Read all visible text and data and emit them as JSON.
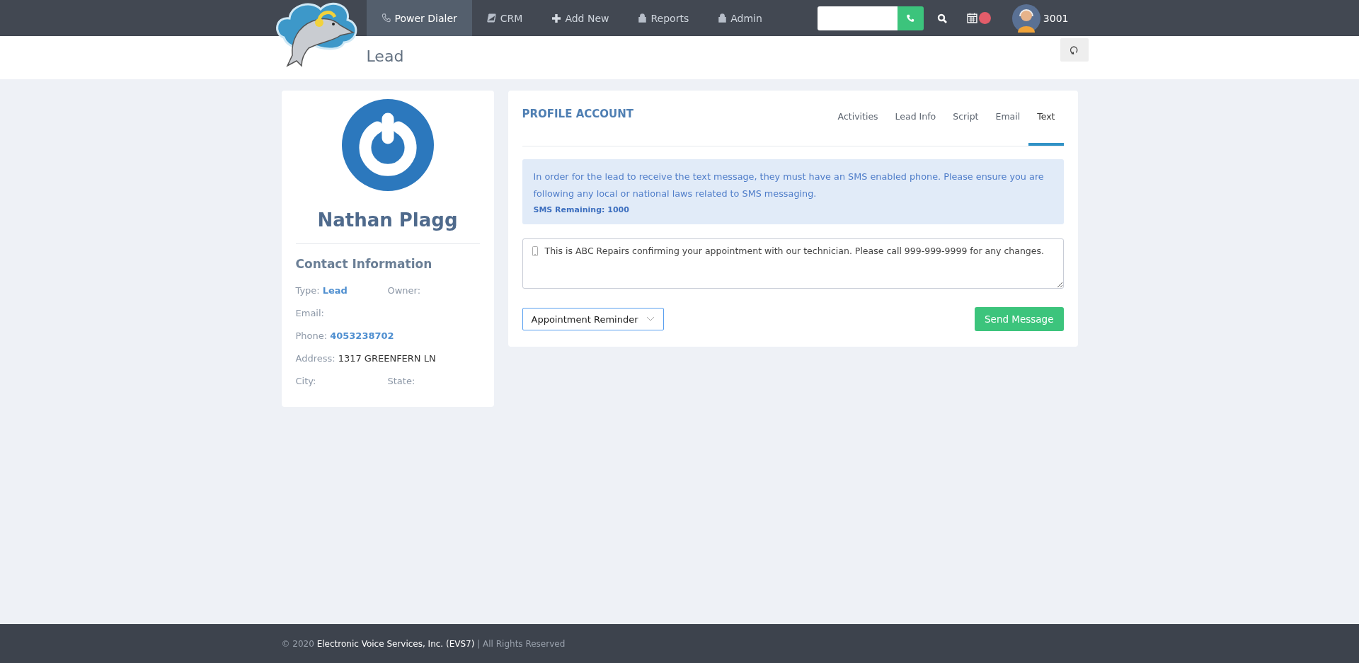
{
  "nav": {
    "items": [
      {
        "label": "Power Dialer",
        "kind": "phone",
        "selected": true
      },
      {
        "label": "CRM",
        "kind": "book",
        "selected": false
      },
      {
        "label": "Add New",
        "kind": "plus",
        "selected": false
      },
      {
        "label": "Reports",
        "kind": "lock",
        "selected": false
      },
      {
        "label": "Admin",
        "kind": "lock",
        "selected": false
      }
    ],
    "calendar_alert": true,
    "user": "3001"
  },
  "page_title": "Lead",
  "profile": {
    "name": "Nathan Plagg",
    "section_title": "Contact Information",
    "rows": [
      [
        {
          "label": "Type:",
          "value": "Lead",
          "kind": "link"
        },
        {
          "label": "Owner:"
        }
      ],
      [
        {
          "label": "Email:"
        }
      ],
      [
        {
          "label": "Phone:",
          "value": "4053238702",
          "kind": "link"
        }
      ],
      [
        {
          "label": "Address:",
          "value": "1317 GREENFERN LN",
          "kind": "text"
        }
      ],
      [
        {
          "label": "City:"
        },
        {
          "label": "State:"
        }
      ]
    ]
  },
  "panel": {
    "title": "PROFILE ACCOUNT",
    "tabs": [
      {
        "label": "Activities",
        "selected": false
      },
      {
        "label": "Lead Info",
        "selected": false
      },
      {
        "label": "Script",
        "selected": false
      },
      {
        "label": "Email",
        "selected": false
      },
      {
        "label": "Text",
        "selected": true
      }
    ],
    "notice": "In order for the lead to receive the text message, they must have an SMS enabled phone. Please ensure you are following any local or national laws related to SMS messaging.",
    "sms_remaining": "SMS Remaining: 1000",
    "message": "This is ABC Repairs confirming your appointment with our technician. Please call 999-999-9999 for any changes.",
    "template": "Appointment Reminder",
    "send_button": "Send Message"
  },
  "footer": {
    "prefix": "© 2020",
    "link": "Electronic Voice Services, Inc. (EVS7)",
    "suffix": "| All Rights Reserved"
  }
}
